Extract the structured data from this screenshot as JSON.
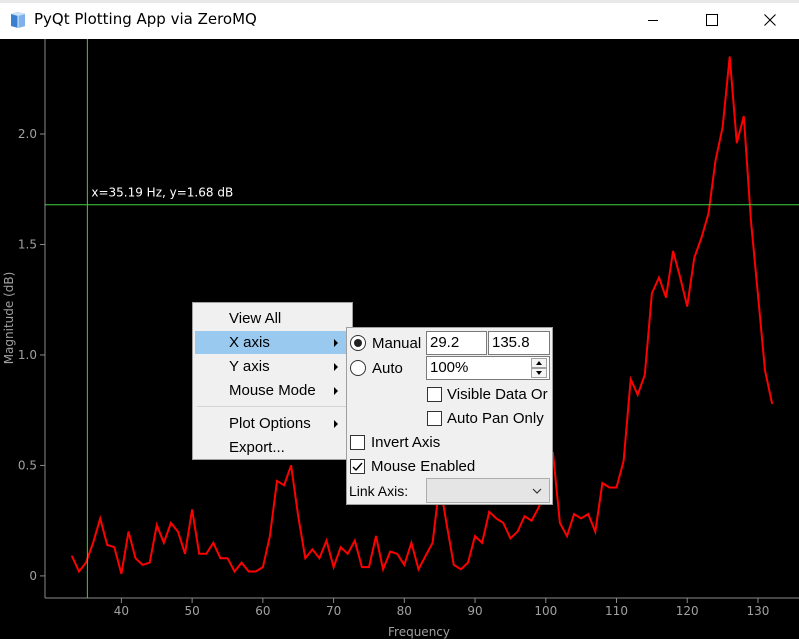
{
  "window": {
    "title": "PyQt Plotting App via ZeroMQ"
  },
  "plot": {
    "cursor_readout": "x=35.19 Hz, y=1.68 dB"
  },
  "chart_data": {
    "type": "line",
    "xlabel": "Frequency",
    "ylabel": "Magnitude (dB)",
    "xlim": [
      29.2,
      135.8
    ],
    "ylim": [
      -0.1,
      2.43
    ],
    "x_ticks": [
      "40",
      "50",
      "60",
      "70",
      "80",
      "90",
      "100",
      "110",
      "120",
      "130"
    ],
    "y_ticks": [
      "0",
      "0.5",
      "1.0",
      "1.5",
      "2.0"
    ],
    "crosshair": {
      "x": 35.19,
      "y": 1.68
    },
    "line_color": "#ff0000",
    "crosshair_color": "#3fcf3f",
    "series": [
      {
        "x": [
          33,
          34,
          35,
          36,
          37,
          38,
          39,
          40,
          41,
          42,
          43,
          44,
          45,
          46,
          47,
          48,
          49,
          50,
          51,
          52,
          53,
          54,
          55,
          56,
          57,
          58,
          59,
          60,
          61,
          62,
          63,
          64,
          65,
          66,
          67,
          68,
          69,
          70,
          71,
          72,
          73,
          74,
          75,
          76,
          77,
          78,
          79,
          80,
          81,
          82,
          83,
          84,
          85,
          86,
          87,
          88,
          89,
          90,
          91,
          92,
          93,
          94,
          95,
          96,
          97,
          98,
          99,
          100,
          101,
          102,
          103,
          104,
          105,
          106,
          107,
          108,
          109,
          110,
          111,
          112,
          113,
          114,
          115,
          116,
          117,
          118,
          119,
          120,
          121,
          122,
          123,
          124,
          125,
          126,
          127,
          128,
          129,
          130,
          131,
          132
        ],
        "y": [
          0.09,
          0.02,
          0.06,
          0.15,
          0.26,
          0.14,
          0.13,
          0.01,
          0.2,
          0.08,
          0.05,
          0.06,
          0.23,
          0.15,
          0.24,
          0.2,
          0.1,
          0.3,
          0.1,
          0.1,
          0.15,
          0.08,
          0.08,
          0.02,
          0.06,
          0.02,
          0.02,
          0.04,
          0.18,
          0.43,
          0.41,
          0.5,
          0.27,
          0.08,
          0.12,
          0.08,
          0.16,
          0.04,
          0.13,
          0.1,
          0.16,
          0.04,
          0.04,
          0.18,
          0.03,
          0.11,
          0.1,
          0.05,
          0.15,
          0.03,
          0.09,
          0.15,
          0.42,
          0.23,
          0.05,
          0.03,
          0.06,
          0.18,
          0.15,
          0.29,
          0.26,
          0.24,
          0.17,
          0.2,
          0.27,
          0.25,
          0.31,
          0.39,
          0.56,
          0.24,
          0.18,
          0.28,
          0.26,
          0.28,
          0.2,
          0.42,
          0.4,
          0.4,
          0.52,
          0.89,
          0.82,
          0.91,
          1.28,
          1.35,
          1.26,
          1.47,
          1.35,
          1.22,
          1.44,
          1.53,
          1.64,
          1.88,
          2.03,
          2.35,
          1.96,
          2.08,
          1.61,
          1.27,
          0.93,
          0.78
        ]
      }
    ]
  },
  "context_menu": {
    "items": [
      {
        "label": "View All"
      },
      {
        "label": "X axis",
        "has_submenu": true,
        "selected": true
      },
      {
        "label": "Y axis",
        "has_submenu": true
      },
      {
        "label": "Mouse Mode",
        "has_submenu": true
      },
      {
        "label": "Plot Options",
        "has_submenu": true
      },
      {
        "label": "Export..."
      }
    ]
  },
  "x_axis_submenu": {
    "manual_label": "Manual",
    "manual_selected": true,
    "min_value": "29.2",
    "max_value": "135.8",
    "auto_label": "Auto",
    "auto_value": "100%",
    "visible_data_label": "Visible Data Or",
    "visible_data_checked": false,
    "auto_pan_label": "Auto Pan Only",
    "auto_pan_checked": false,
    "invert_axis_label": "Invert Axis",
    "invert_axis_checked": false,
    "mouse_enabled_label": "Mouse Enabled",
    "mouse_enabled_checked": true,
    "link_axis_label": "Link Axis:",
    "link_axis_value": ""
  }
}
